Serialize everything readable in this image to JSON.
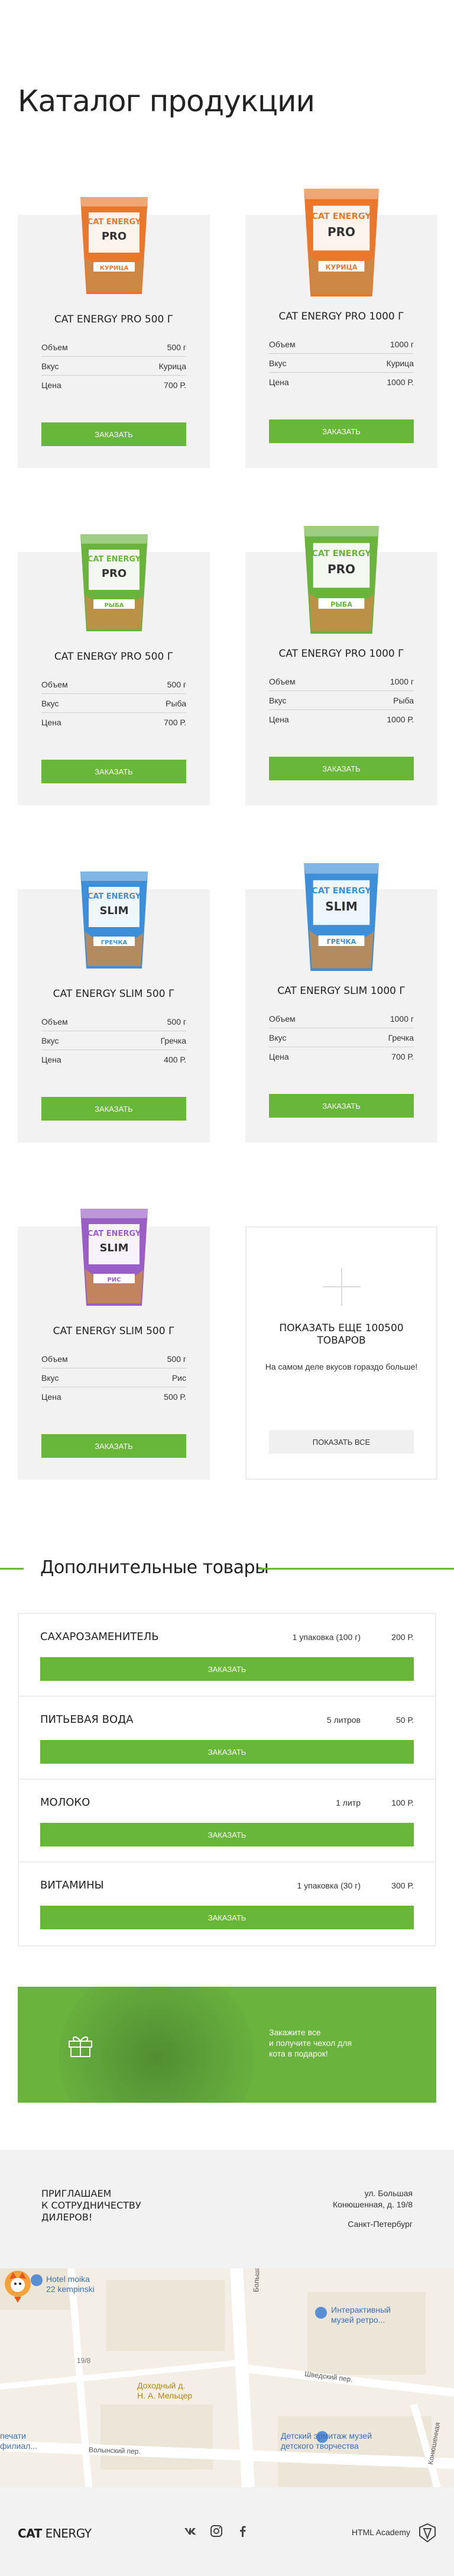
{
  "page_title": "Каталог продукции",
  "spec_labels": {
    "volume": "Объем",
    "taste": "Вкус",
    "price": "Цена"
  },
  "products": [
    {
      "name": "CAT ENERGY PRO 500 Г",
      "volume": "500 г",
      "taste": "Курица",
      "price": "700 Р.",
      "button": "Заказать",
      "pack_line": "PRO",
      "pack_flavor": "КУРИЦА",
      "pack_color": "#e9782c"
    },
    {
      "name": "CAT ENERGY PRO 1000 Г",
      "volume": "1000 г",
      "taste": "Курица",
      "price": "1000 Р.",
      "button": "Заказать",
      "pack_line": "PRO",
      "pack_flavor": "КУРИЦА",
      "pack_color": "#e9782c"
    },
    {
      "name": "CAT ENERGY PRO 500 Г",
      "volume": "500 г",
      "taste": "Рыба",
      "price": "700 Р.",
      "button": "Заказать",
      "pack_line": "PRO",
      "pack_flavor": "РЫБА",
      "pack_color": "#6ab43e"
    },
    {
      "name": "CAT ENERGY PRO 1000 Г",
      "volume": "1000 г",
      "taste": "Рыба",
      "price": "1000 Р.",
      "button": "Заказать",
      "pack_line": "PRO",
      "pack_flavor": "РЫБА",
      "pack_color": "#6ab43e"
    },
    {
      "name": "CAT ENERGY SLIM 500 Г",
      "volume": "500 г",
      "taste": "Гречка",
      "price": "400 Р.",
      "button": "Заказать",
      "pack_line": "SLIM",
      "pack_flavor": "ГРЕЧКА",
      "pack_color": "#3c8fd8"
    },
    {
      "name": "CAT ENERGY SLIM 1000 Г",
      "volume": "1000 г",
      "taste": "Гречка",
      "price": "700 Р.",
      "button": "Заказать",
      "pack_line": "SLIM",
      "pack_flavor": "ГРЕЧКА",
      "pack_color": "#3c8fd8"
    },
    {
      "name": "CAT ENERGY SLIM 500 Г",
      "volume": "500 г",
      "taste": "Рис",
      "price": "500 Р.",
      "button": "Заказать",
      "pack_line": "SLIM",
      "pack_flavor": "РИС",
      "pack_color": "#9a5fc7"
    }
  ],
  "pack_brand": "CAT ENERGY",
  "more": {
    "title": "Показать еще 100500 товаров",
    "text": "На самом деле вкусов гораздо больше!",
    "button": "Показать все"
  },
  "additional": {
    "title": "Дополнительные товары",
    "items": [
      {
        "name": "Сахарозаменитель",
        "amount": "1 упаковка (100 г)",
        "price": "200 Р.",
        "button": "Заказать"
      },
      {
        "name": "Питьевая вода",
        "amount": "5 литров",
        "price": "50 Р.",
        "button": "Заказать"
      },
      {
        "name": "Молоко",
        "amount": "1 литр",
        "price": "100 Р.",
        "button": "Заказать"
      },
      {
        "name": "Витамины",
        "amount": "1 упаковка (30 г)",
        "price": "300 Р.",
        "button": "Заказать"
      }
    ]
  },
  "promo": {
    "line1": "Закажите все",
    "line2": "и получите чехол для",
    "line3": "кота в подарок!"
  },
  "partner": {
    "line1": "Приглашаем",
    "line2": "к сотрудничеству",
    "line3": "дилеров!",
    "street": "ул. Большая",
    "house": "Конюшенная, д. 19/8",
    "city": "Санкт-Петербург"
  },
  "map": {
    "hotel": "Hotel moika",
    "hotel2": "22 kempinski",
    "museum": "Интерактивный",
    "museum2": "музей ретро...",
    "house": "Доходный д.",
    "house2": "Н. А. Мельцер",
    "hermitage": "Детский эрмитаж музей",
    "hermitage2": "детского творчества",
    "print": "печати",
    "print2": "филиал...",
    "street_b_kon": "Большая Кон.",
    "street_shved": "Шведский пер.",
    "street_volyn": "Волынский пер.",
    "street_kon": "Конюшенная",
    "house_num": "19/8",
    "colors": {
      "park": "#d7ead0",
      "road": "#ffffff",
      "block": "#ece6d9"
    }
  },
  "footer": {
    "logo_bold": "CAT",
    "logo_light": " ENERGY",
    "academy": "HTML Academy"
  },
  "colors": {
    "accent": "#68b738",
    "card_bg": "#f2f2f2",
    "border": "#eeeeee"
  }
}
